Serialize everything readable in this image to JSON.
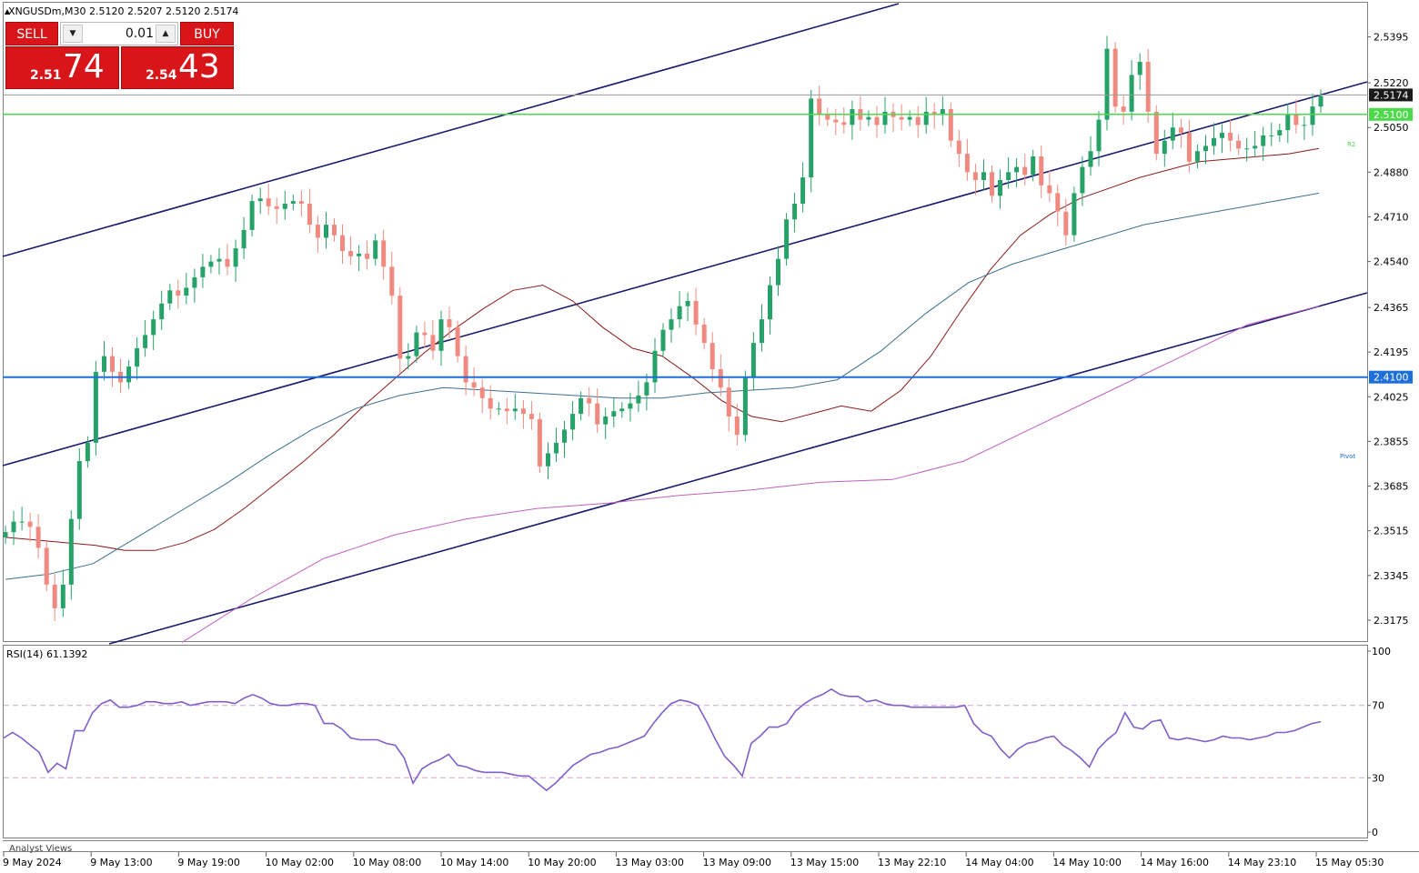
{
  "symbol_header": "XNGUSDm,M30  2.5120 2.5207 2.5120 2.5174",
  "trade_panel": {
    "sell_label": "SELL",
    "buy_label": "BUY",
    "lot_value": "0.01",
    "sell_price_small": "2.51",
    "sell_price_big": "74",
    "buy_price_small": "2.54",
    "buy_price_big": "43"
  },
  "colors": {
    "bull": "#26a269",
    "bear": "#f08a80",
    "ma_red": "#8b1a1a",
    "ma_blue": "#3b6f8f",
    "ma_purple": "#c060c0",
    "channel": "#1a1a6e",
    "support": "#1e6fd9",
    "resistance": "#4cd94c",
    "rsi": "#8060c8"
  },
  "chart_data": {
    "type": "candlestick",
    "title": "XNGUSDm,M30  2.5120 2.5207 2.5120 2.5174",
    "current_price": "2.5174",
    "x_tick_labels": [
      "9 May 2024",
      "9 May 13:00",
      "9 May 19:00",
      "10 May 02:00",
      "10 May 08:00",
      "10 May 14:00",
      "10 May 20:00",
      "13 May 03:00",
      "13 May 09:00",
      "13 May 15:00",
      "13 May 22:10",
      "14 May 04:00",
      "14 May 10:00",
      "14 May 16:00",
      "14 May 23:10",
      "15 May 05:30"
    ],
    "y_tick_labels": [
      "2.5395",
      "2.5220",
      "2.5050",
      "2.4880",
      "2.4710",
      "2.4540",
      "2.4365",
      "2.4195",
      "2.4025",
      "2.3855",
      "2.3685",
      "2.3515",
      "2.3345",
      "2.3175"
    ],
    "ylim": [
      2.3095,
      2.5525
    ],
    "horizontal_levels": [
      {
        "name": "resistance",
        "value": 2.51,
        "label": "2.5100"
      },
      {
        "name": "support",
        "value": 2.41,
        "label": "2.4100"
      }
    ],
    "level_markers": [
      "R2",
      "Pivot"
    ],
    "close": [
      2.351,
      2.355,
      2.355,
      2.353,
      2.345,
      2.331,
      2.322,
      2.331,
      2.356,
      2.378,
      2.385,
      2.412,
      2.418,
      2.412,
      2.408,
      2.414,
      2.421,
      2.426,
      2.432,
      2.438,
      2.443,
      2.441,
      2.444,
      2.448,
      2.452,
      2.454,
      2.455,
      2.452,
      2.459,
      2.466,
      2.477,
      2.478,
      2.475,
      2.474,
      2.476,
      2.477,
      2.476,
      2.468,
      2.463,
      2.468,
      2.464,
      2.458,
      2.456,
      2.457,
      2.455,
      2.462,
      2.452,
      2.441,
      2.417,
      2.418,
      2.427,
      2.426,
      2.42,
      2.432,
      2.429,
      2.418,
      2.408,
      2.406,
      2.402,
      2.398,
      2.398,
      2.397,
      2.398,
      2.396,
      2.394,
      2.376,
      2.381,
      2.385,
      2.39,
      2.396,
      2.402,
      2.4,
      2.392,
      2.395,
      2.397,
      2.398,
      2.4,
      2.403,
      2.408,
      2.42,
      2.428,
      2.432,
      2.437,
      2.439,
      2.43,
      2.423,
      2.413,
      2.406,
      2.395,
      2.388,
      2.41,
      2.423,
      2.432,
      2.445,
      2.455,
      2.47,
      2.476,
      2.486,
      2.516,
      2.51,
      2.508,
      2.507,
      2.506,
      2.512,
      2.508,
      2.509,
      2.506,
      2.511,
      2.509,
      2.508,
      2.509,
      2.506,
      2.511,
      2.51,
      2.512,
      2.5,
      2.495,
      2.488,
      2.485,
      2.488,
      2.479,
      2.485,
      2.488,
      2.49,
      2.487,
      2.494,
      2.483,
      2.48,
      2.473,
      2.464,
      2.48,
      2.49,
      2.496,
      2.508,
      2.535,
      2.513,
      2.511,
      2.525,
      2.53,
      2.511,
      2.495,
      2.5,
      2.505,
      2.503,
      2.492,
      2.496,
      2.498,
      2.501,
      2.503,
      2.5,
      2.497,
      2.497,
      2.498,
      2.502,
      2.502,
      2.504,
      2.51,
      2.506,
      2.506,
      2.513,
      2.517
    ],
    "ma_red": [
      2.349,
      2.348,
      2.347,
      2.346,
      2.344,
      2.344,
      2.347,
      2.352,
      2.36,
      2.369,
      2.378,
      2.388,
      2.399,
      2.409,
      2.419,
      2.428,
      2.436,
      2.443,
      2.445,
      2.439,
      2.429,
      2.421,
      2.418,
      2.41,
      2.401,
      2.395,
      2.393,
      2.396,
      2.399,
      2.397,
      2.405,
      2.418,
      2.435,
      2.451,
      2.464,
      2.472,
      2.478,
      2.482,
      2.486,
      2.489,
      2.492,
      2.493,
      2.494,
      2.495,
      2.497
    ],
    "ma_blue": [
      2.333,
      2.335,
      2.339,
      2.349,
      2.359,
      2.369,
      2.38,
      2.39,
      2.398,
      2.403,
      2.406,
      2.405,
      2.404,
      2.403,
      2.402,
      2.402,
      2.404,
      2.405,
      2.406,
      2.409,
      2.42,
      2.434,
      2.446,
      2.453,
      2.458,
      2.463,
      2.468,
      2.471,
      2.474,
      2.477,
      2.48
    ],
    "ma_purple": [
      2.309,
      2.326,
      2.341,
      2.35,
      2.356,
      2.36,
      2.362,
      2.365,
      2.367,
      2.37,
      2.371,
      2.378,
      2.391,
      2.404,
      2.417,
      2.43,
      2.437
    ],
    "rsi": {
      "label": "RSI(14) 61.1392",
      "levels": [
        30,
        70
      ],
      "y_tick_labels": [
        "100",
        "70",
        "30",
        "0"
      ],
      "ylim": [
        0,
        100
      ],
      "values": [
        52,
        55,
        52,
        48,
        44,
        33,
        38,
        35,
        56,
        56,
        66,
        71,
        73,
        69,
        69,
        70,
        72,
        72,
        71,
        71,
        72,
        70,
        71,
        72,
        72,
        72,
        71,
        74,
        76,
        74,
        71,
        70,
        70,
        71,
        71,
        70,
        60,
        60,
        57,
        52,
        51,
        51,
        51,
        49,
        48,
        41,
        27,
        35,
        38,
        40,
        43,
        37,
        36,
        34,
        33,
        33,
        33,
        32,
        31,
        31,
        27,
        23,
        27,
        32,
        37,
        40,
        43,
        44,
        46,
        47,
        49,
        51,
        53,
        60,
        66,
        71,
        73,
        72,
        70,
        61,
        51,
        42,
        37,
        31,
        49,
        53,
        58,
        58,
        60,
        67,
        71,
        74,
        76,
        79,
        76,
        75,
        75,
        72,
        73,
        71,
        70,
        70,
        69,
        69,
        69,
        69,
        69,
        69,
        70,
        60,
        55,
        53,
        46,
        41,
        46,
        49,
        50,
        52,
        53,
        48,
        45,
        41,
        36,
        46,
        51,
        55,
        66,
        58,
        57,
        61,
        62,
        52,
        51,
        52,
        51,
        50,
        51,
        53,
        52,
        52,
        51,
        52,
        53,
        55,
        55,
        56,
        58,
        60,
        61
      ]
    }
  }
}
